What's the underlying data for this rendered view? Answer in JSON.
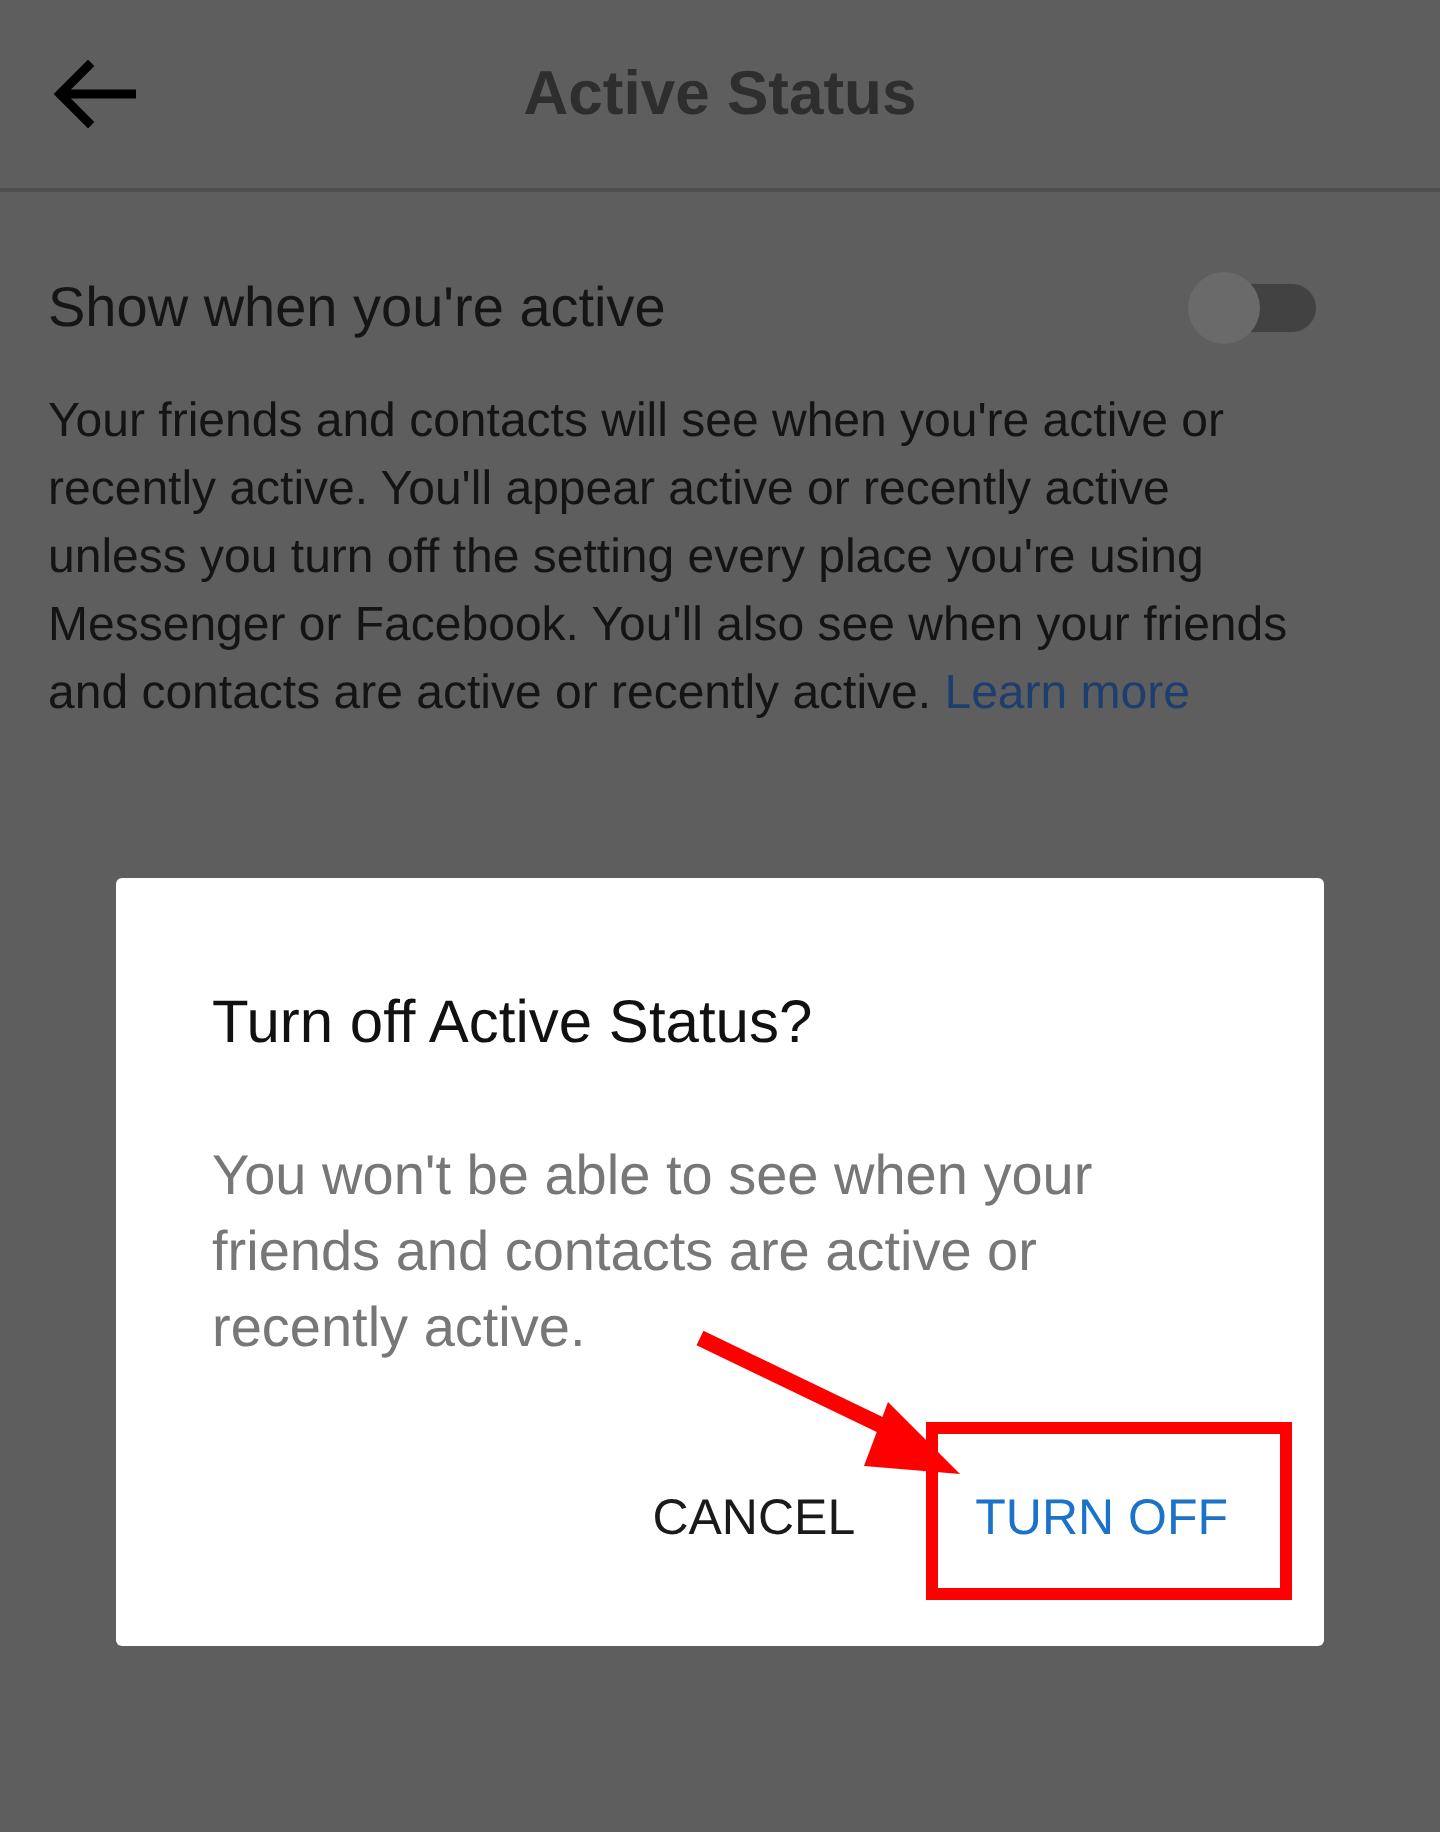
{
  "header": {
    "title": "Active Status"
  },
  "setting": {
    "label": "Show when you're active",
    "on": false
  },
  "description": {
    "text": "Your friends and contacts will see when you're active or recently active. You'll appear active or recently active unless you turn off the setting every place you're using Messenger or Facebook. You'll also see when your friends and contacts are active or recently active.",
    "link": "Learn more"
  },
  "dialog": {
    "title": "Turn off Active Status?",
    "message": "You won't be able to see when your friends and contacts are active or recently active.",
    "buttons": [
      {
        "label": "CANCEL",
        "kind": "neutral"
      },
      {
        "label": "TURN OFF",
        "kind": "primary"
      }
    ]
  }
}
